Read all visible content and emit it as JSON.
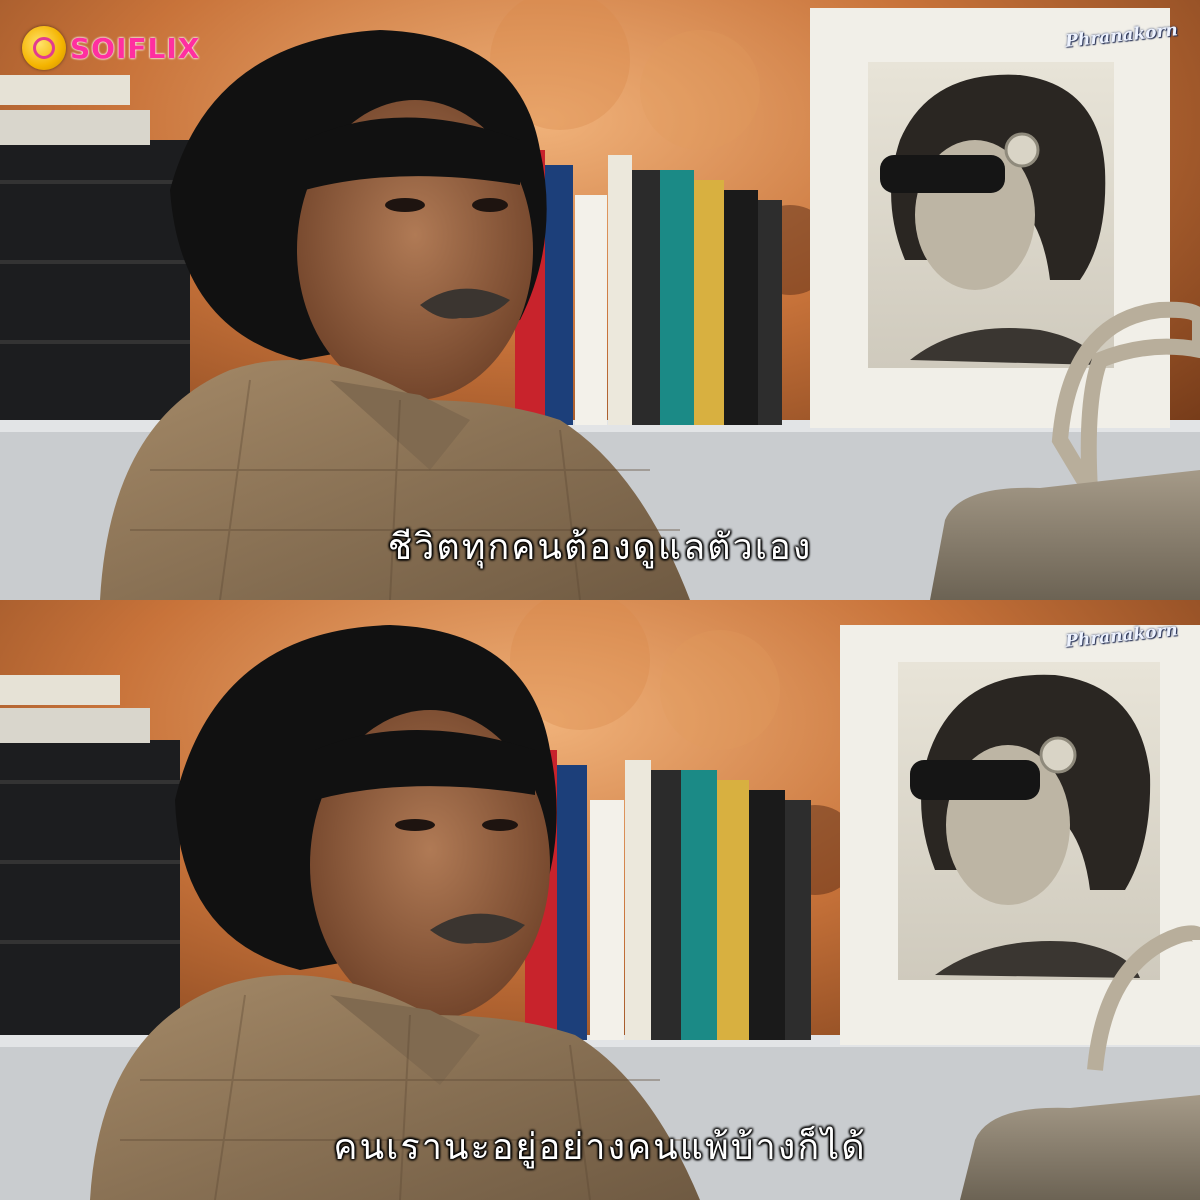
{
  "brand": {
    "logo_text": "SOIFLIX",
    "logo_color": "#ff2fa0"
  },
  "watermark": {
    "text": "Phranakorn"
  },
  "frames": [
    {
      "subtitle": "ชีวิตทุกคนต้องดูแลตัวเอง"
    },
    {
      "subtitle": "คนเรานะอยู่อย่างคนแพ้บ้างก็ได้"
    }
  ],
  "colors": {
    "wall": "#b8612a",
    "shirt": "#8a7357",
    "shelf": "#c9cccf",
    "frame_white": "#f1efe8"
  }
}
